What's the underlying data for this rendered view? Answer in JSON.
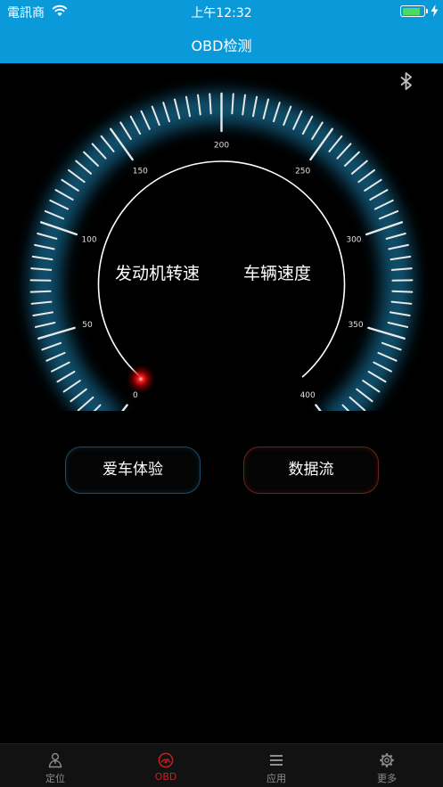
{
  "status_bar": {
    "carrier": "電訊商",
    "time": "上午12:32",
    "battery_level": 0.9
  },
  "nav": {
    "title": "OBD检测"
  },
  "gauge": {
    "scale": {
      "min": 0,
      "max": 400,
      "major_tick_step": 50,
      "tick_labels": [
        "0",
        "50",
        "100",
        "150",
        "200",
        "250",
        "300",
        "350",
        "400"
      ]
    },
    "value": 0,
    "labels": {
      "engine_rpm": "发动机转速",
      "vehicle_speed": "车辆速度"
    },
    "colors": {
      "tick": "#e8e8e8",
      "glow": "#1e8fc2",
      "arc": "#ffffff",
      "indicator": "#ff1a1a"
    }
  },
  "actions": {
    "car_experience": "爱车体验",
    "data_flow": "数据流"
  },
  "tabs": [
    {
      "label": "定位",
      "icon": "location-person-icon",
      "active": false
    },
    {
      "label": "OBD",
      "icon": "obd-gauge-icon",
      "active": true
    },
    {
      "label": "应用",
      "icon": "list-icon",
      "active": false
    },
    {
      "label": "更多",
      "icon": "gear-icon",
      "active": false
    }
  ]
}
